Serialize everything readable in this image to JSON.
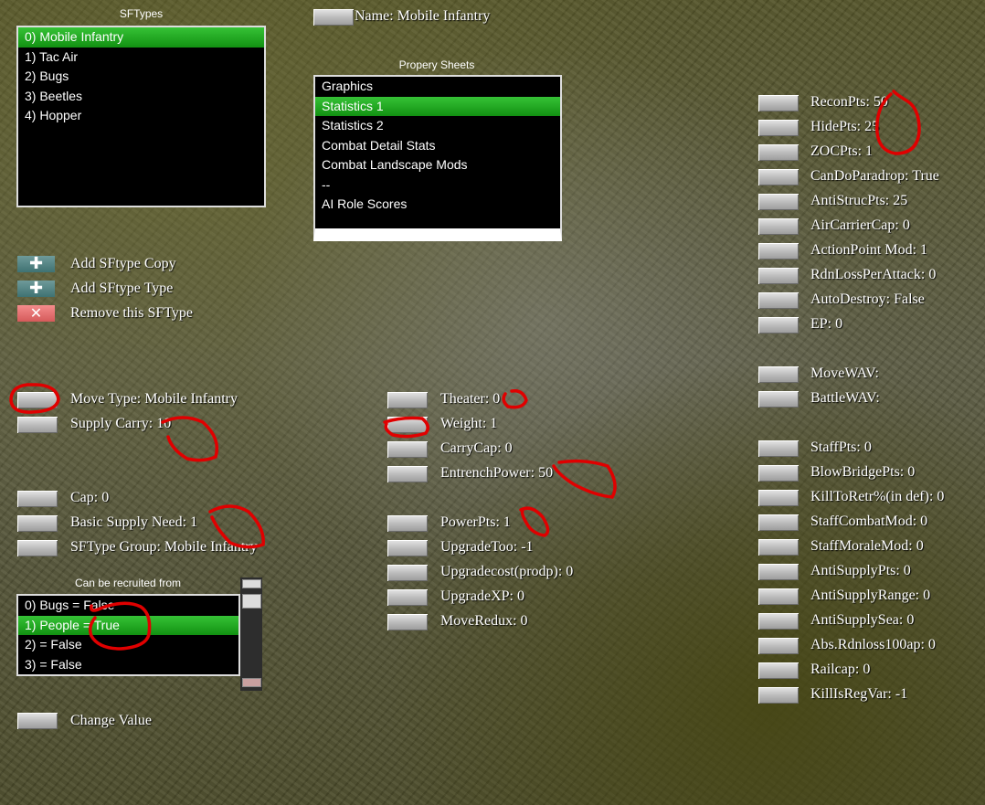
{
  "sftypes": {
    "caption": "SFTypes",
    "items": [
      "0) Mobile Infantry",
      "1) Tac Air",
      "2) Bugs",
      "3) Beetles",
      "4) Hopper"
    ],
    "selected": 0
  },
  "name_field": {
    "label": "Name: Mobile Infantry"
  },
  "property_sheets": {
    "caption": "Propery Sheets",
    "items": [
      "Graphics",
      "Statistics 1",
      "Statistics 2",
      "Combat Detail Stats",
      "Combat Landscape Mods",
      "--",
      "AI Role Scores"
    ],
    "selected": 1
  },
  "actions": {
    "add_copy": "Add SFtype Copy",
    "add_type": "Add SFtype Type",
    "remove": "Remove this SFType",
    "plus_glyph": "✚",
    "x_glyph": "✕"
  },
  "left_stats": {
    "move_type": "Move Type: Mobile Infantry",
    "supply_carry": "Supply Carry: 10",
    "cap": "Cap: 0",
    "basic_supply_need": "Basic Supply Need: 1",
    "sftype_group": "SFType Group: Mobile Infantry"
  },
  "recruit": {
    "caption": "Can be recruited from",
    "items": [
      "0) Bugs = False",
      "1) People = True",
      "2) = False",
      "3) = False"
    ],
    "selected": 1
  },
  "change_value": "Change Value",
  "mid_stats": {
    "theater": "Theater: 0",
    "weight": "Weight: 1",
    "carrycap": "CarryCap: 0",
    "entrench": "EntrenchPower: 50",
    "powerpts": "PowerPts: 1",
    "upgradetoo": "UpgradeToo: -1",
    "upgradecost": "Upgradecost(prodp): 0",
    "upgradexp": "UpgradeXP: 0",
    "moveredux": "MoveRedux: 0"
  },
  "right_stats": {
    "group1": [
      "ReconPts: 50",
      "HidePts: 25",
      "ZOCPts: 1",
      "CanDoParadrop: True",
      "AntiStrucPts: 25",
      "AirCarrierCap: 0",
      "ActionPoint Mod: 1",
      "RdnLossPerAttack: 0",
      "AutoDestroy: False",
      "EP: 0"
    ],
    "group2": [
      "MoveWAV:",
      "BattleWAV:"
    ],
    "group3": [
      "StaffPts: 0",
      "BlowBridgePts: 0",
      "KillToRetr%(in def): 0",
      "StaffCombatMod: 0",
      "StaffMoraleMod: 0",
      "AntiSupplyPts: 0",
      "AntiSupplyRange: 0",
      "AntiSupplySea: 0",
      "Abs.Rdnloss100ap: 0",
      "Railcap: 0",
      "KillIsRegVar: -1"
    ]
  }
}
